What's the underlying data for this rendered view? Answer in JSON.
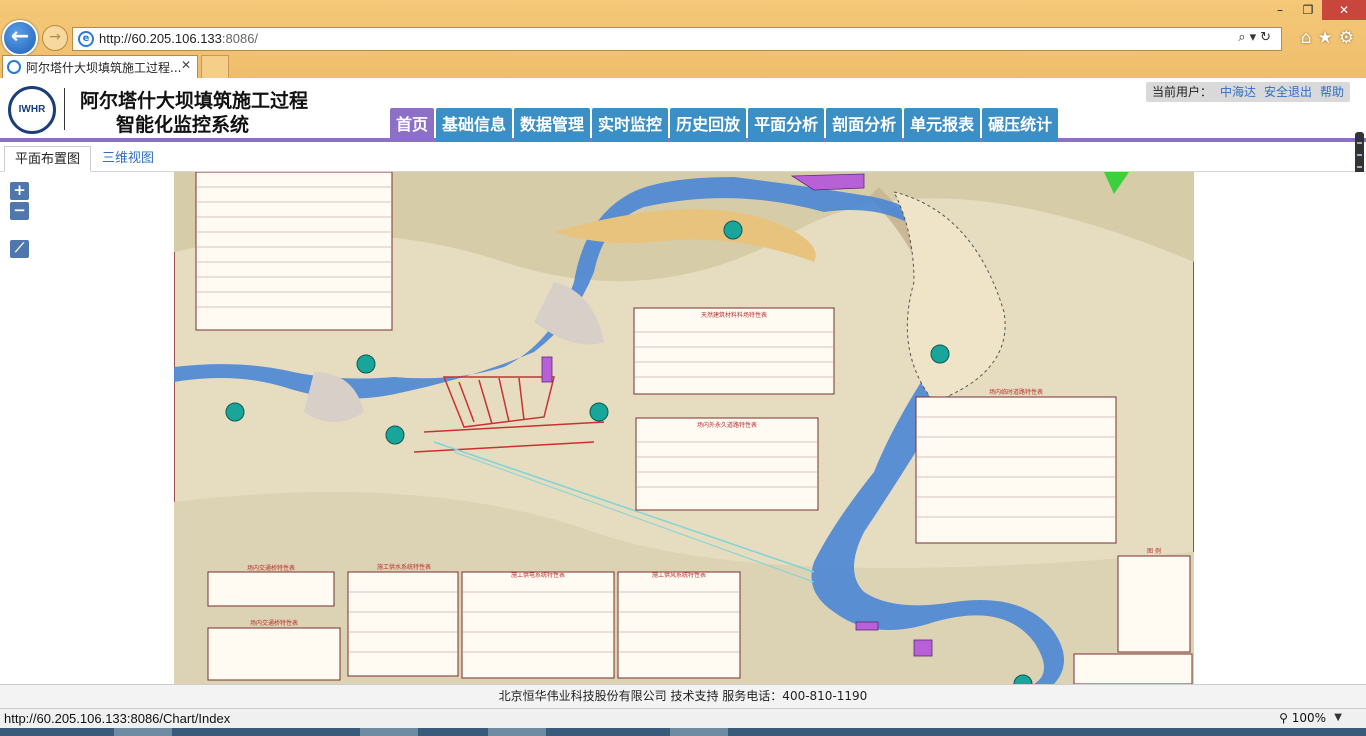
{
  "browser": {
    "url_host": "http://60.205.106.133",
    "url_port": ":8086/",
    "tab_title": "阿尔塔什大坝填筑施工过程...",
    "status_url": "http://60.205.106.133:8086/Chart/Index",
    "zoom": "100%"
  },
  "header": {
    "logo_text": "IWHR",
    "title_line1": "阿尔塔什大坝填筑施工过程",
    "title_line2": "智能化监控系统",
    "user_label": "当前用户：",
    "user_name": "中海达",
    "logout": "安全退出",
    "help": "帮助"
  },
  "nav": [
    "首页",
    "基础信息",
    "数据管理",
    "实时监控",
    "历史回放",
    "平面分析",
    "剖面分析",
    "单元报表",
    "碾压统计"
  ],
  "sub_tabs": {
    "plan": "平面布置图",
    "view3d": "三维视图"
  },
  "map_controls": {
    "zoom_in": "+",
    "zoom_out": "−"
  },
  "map_tables": {
    "t1": "天然建筑材料料场特性表",
    "t2": "场内外永久道路特性表",
    "t3": "场内临时道路特性表",
    "t4": "场内交通桥特性表",
    "t5": "施工供水系统特性表",
    "t6": "施工供电系统特性表",
    "t7": "施工供风系统特性表",
    "t8": "场内交通桥特性表",
    "legend": "图 例"
  },
  "footer": "北京恒华伟业科技股份有限公司 技术支持  服务电话：400-810-1190"
}
